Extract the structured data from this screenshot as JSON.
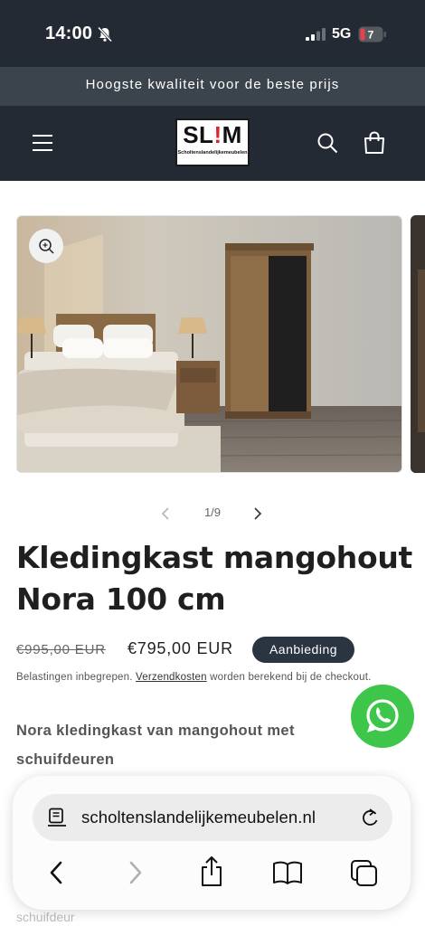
{
  "status_bar": {
    "time": "14:00",
    "network": "5G",
    "battery": "7"
  },
  "announcement": "Hoogste kwaliteit voor de beste prijs",
  "header": {
    "logo_main_left": "SL",
    "logo_main_bang": "!",
    "logo_main_right": "M",
    "logo_sub": "Scholtenslandelijkemeubelen"
  },
  "gallery": {
    "counter": "1/9"
  },
  "product": {
    "title": "Kledingkast mangohout Nora 100 cm",
    "price_old": "€995,00 EUR",
    "price_new": "€795,00 EUR",
    "badge": "Aanbieding",
    "tax_prefix": "Belastingen inbegrepen.",
    "tax_link": "Verzendkosten",
    "tax_suffix": "worden berekend bij de checkout.",
    "description_heading": "Nora kledingkast van mangohout met schuifdeuren",
    "faded_text": "schuifdeur"
  },
  "browser": {
    "url": "scholtenslandelijkemeubelen.nl"
  },
  "colors": {
    "header_bg": "#232a33",
    "announce_bg": "#3b434c",
    "badge_bg": "#2b3542",
    "whatsapp": "#3ec64a",
    "logo_accent": "#d9262e"
  },
  "icons": [
    "bell-off-icon",
    "signal-icon",
    "battery-icon",
    "menu-icon",
    "search-icon",
    "cart-icon",
    "zoom-icon",
    "chevron-left-icon",
    "chevron-right-icon",
    "whatsapp-icon",
    "page-icon",
    "reload-icon",
    "back-icon",
    "forward-icon",
    "share-icon",
    "bookmarks-icon",
    "tabs-icon"
  ]
}
